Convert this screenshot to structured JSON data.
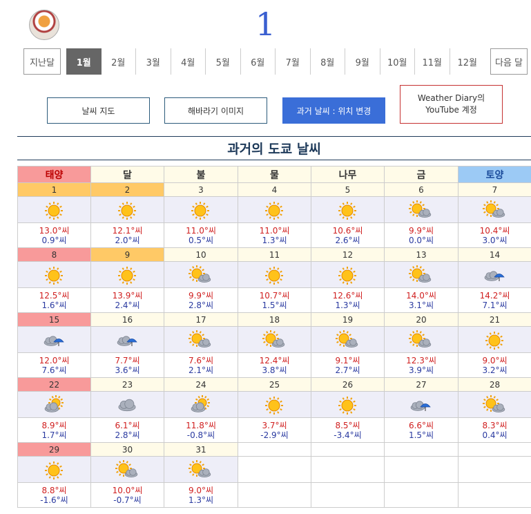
{
  "header": {
    "month_number": "1"
  },
  "months_nav": {
    "prev_label": "지난달",
    "next_label": "다음 달",
    "months": [
      "1월",
      "2월",
      "3월",
      "4월",
      "5월",
      "6월",
      "7월",
      "8월",
      "9월",
      "10월",
      "11월",
      "12월"
    ],
    "active_index": 0
  },
  "links": {
    "weather_map": "날씨 지도",
    "sunflower_image": "해바라기 이미지",
    "past_weather_change": "과거 날씨 : 위치 변경",
    "youtube": "Weather Diary의 YouTube 계정"
  },
  "section_title": "과거의 도쿄 날씨",
  "weekdays": [
    "태양",
    "달",
    "불",
    "물",
    "나무",
    "금",
    "토양"
  ],
  "colors": {
    "sunday_bg": "#f89a9a",
    "saturday_bg": "#9ccaf5",
    "holiday_bg": "#ffc966",
    "active_month": "#666666",
    "primary_btn": "#3a6ed8"
  },
  "days": [
    {
      "d": "1",
      "icon": "sun-icon",
      "hi": "13.0°씨",
      "lo": "0.9°씨",
      "bg": "holiday"
    },
    {
      "d": "2",
      "icon": "sun-icon",
      "hi": "12.1°씨",
      "lo": "2.0°씨",
      "bg": "holiday"
    },
    {
      "d": "3",
      "icon": "sun-icon",
      "hi": "11.0°씨",
      "lo": "0.5°씨"
    },
    {
      "d": "4",
      "icon": "sun-icon",
      "hi": "11.0°씨",
      "lo": "1.3°씨"
    },
    {
      "d": "5",
      "icon": "sun-icon",
      "hi": "10.6°씨",
      "lo": "2.6°씨"
    },
    {
      "d": "6",
      "icon": "sun-cloud-icon",
      "hi": "9.9°씨",
      "lo": "0.0°씨"
    },
    {
      "d": "7",
      "icon": "sun-cloud-icon",
      "hi": "10.4°씨",
      "lo": "3.0°씨"
    },
    {
      "d": "8",
      "icon": "sun-icon",
      "hi": "12.5°씨",
      "lo": "1.6°씨",
      "bg": "sunday"
    },
    {
      "d": "9",
      "icon": "sun-icon",
      "hi": "13.9°씨",
      "lo": "2.4°씨",
      "bg": "holiday"
    },
    {
      "d": "10",
      "icon": "sun-cloud-icon",
      "hi": "9.9°씨",
      "lo": "2.8°씨"
    },
    {
      "d": "11",
      "icon": "sun-icon",
      "hi": "10.7°씨",
      "lo": "1.5°씨"
    },
    {
      "d": "12",
      "icon": "sun-icon",
      "hi": "12.6°씨",
      "lo": "1.3°씨"
    },
    {
      "d": "13",
      "icon": "sun-cloud-icon",
      "hi": "14.0°씨",
      "lo": "3.1°씨"
    },
    {
      "d": "14",
      "icon": "cloud-umbrella-icon",
      "hi": "14.2°씨",
      "lo": "7.1°씨"
    },
    {
      "d": "15",
      "icon": "cloud-umbrella-icon",
      "hi": "12.0°씨",
      "lo": "7.6°씨",
      "bg": "sunday"
    },
    {
      "d": "16",
      "icon": "cloud-umbrella-icon",
      "hi": "7.7°씨",
      "lo": "3.6°씨"
    },
    {
      "d": "17",
      "icon": "sun-cloud-icon",
      "hi": "7.6°씨",
      "lo": "2.1°씨"
    },
    {
      "d": "18",
      "icon": "sun-cloud-icon",
      "hi": "12.4°씨",
      "lo": "3.8°씨"
    },
    {
      "d": "19",
      "icon": "sun-cloud-icon",
      "hi": "9.1°씨",
      "lo": "2.7°씨"
    },
    {
      "d": "20",
      "icon": "sun-cloud-icon",
      "hi": "12.3°씨",
      "lo": "3.9°씨"
    },
    {
      "d": "21",
      "icon": "sun-icon",
      "hi": "9.0°씨",
      "lo": "3.2°씨"
    },
    {
      "d": "22",
      "icon": "cloud-sun-icon",
      "hi": "8.9°씨",
      "lo": "1.7°씨",
      "bg": "sunday"
    },
    {
      "d": "23",
      "icon": "cloud-icon",
      "hi": "6.1°씨",
      "lo": "2.8°씨"
    },
    {
      "d": "24",
      "icon": "cloud-sun-icon",
      "hi": "11.8°씨",
      "lo": "-0.8°씨"
    },
    {
      "d": "25",
      "icon": "sun-icon",
      "hi": "3.7°씨",
      "lo": "-2.9°씨"
    },
    {
      "d": "26",
      "icon": "sun-icon",
      "hi": "8.5°씨",
      "lo": "-3.4°씨"
    },
    {
      "d": "27",
      "icon": "cloud-umbrella-icon",
      "hi": "6.6°씨",
      "lo": "1.5°씨"
    },
    {
      "d": "28",
      "icon": "sun-cloud-icon",
      "hi": "8.3°씨",
      "lo": "0.4°씨"
    },
    {
      "d": "29",
      "icon": "sun-icon",
      "hi": "8.8°씨",
      "lo": "-1.6°씨",
      "bg": "sunday"
    },
    {
      "d": "30",
      "icon": "sun-cloud-icon",
      "hi": "10.0°씨",
      "lo": "-0.7°씨"
    },
    {
      "d": "31",
      "icon": "sun-cloud-icon",
      "hi": "9.0°씨",
      "lo": "1.3°씨"
    }
  ]
}
